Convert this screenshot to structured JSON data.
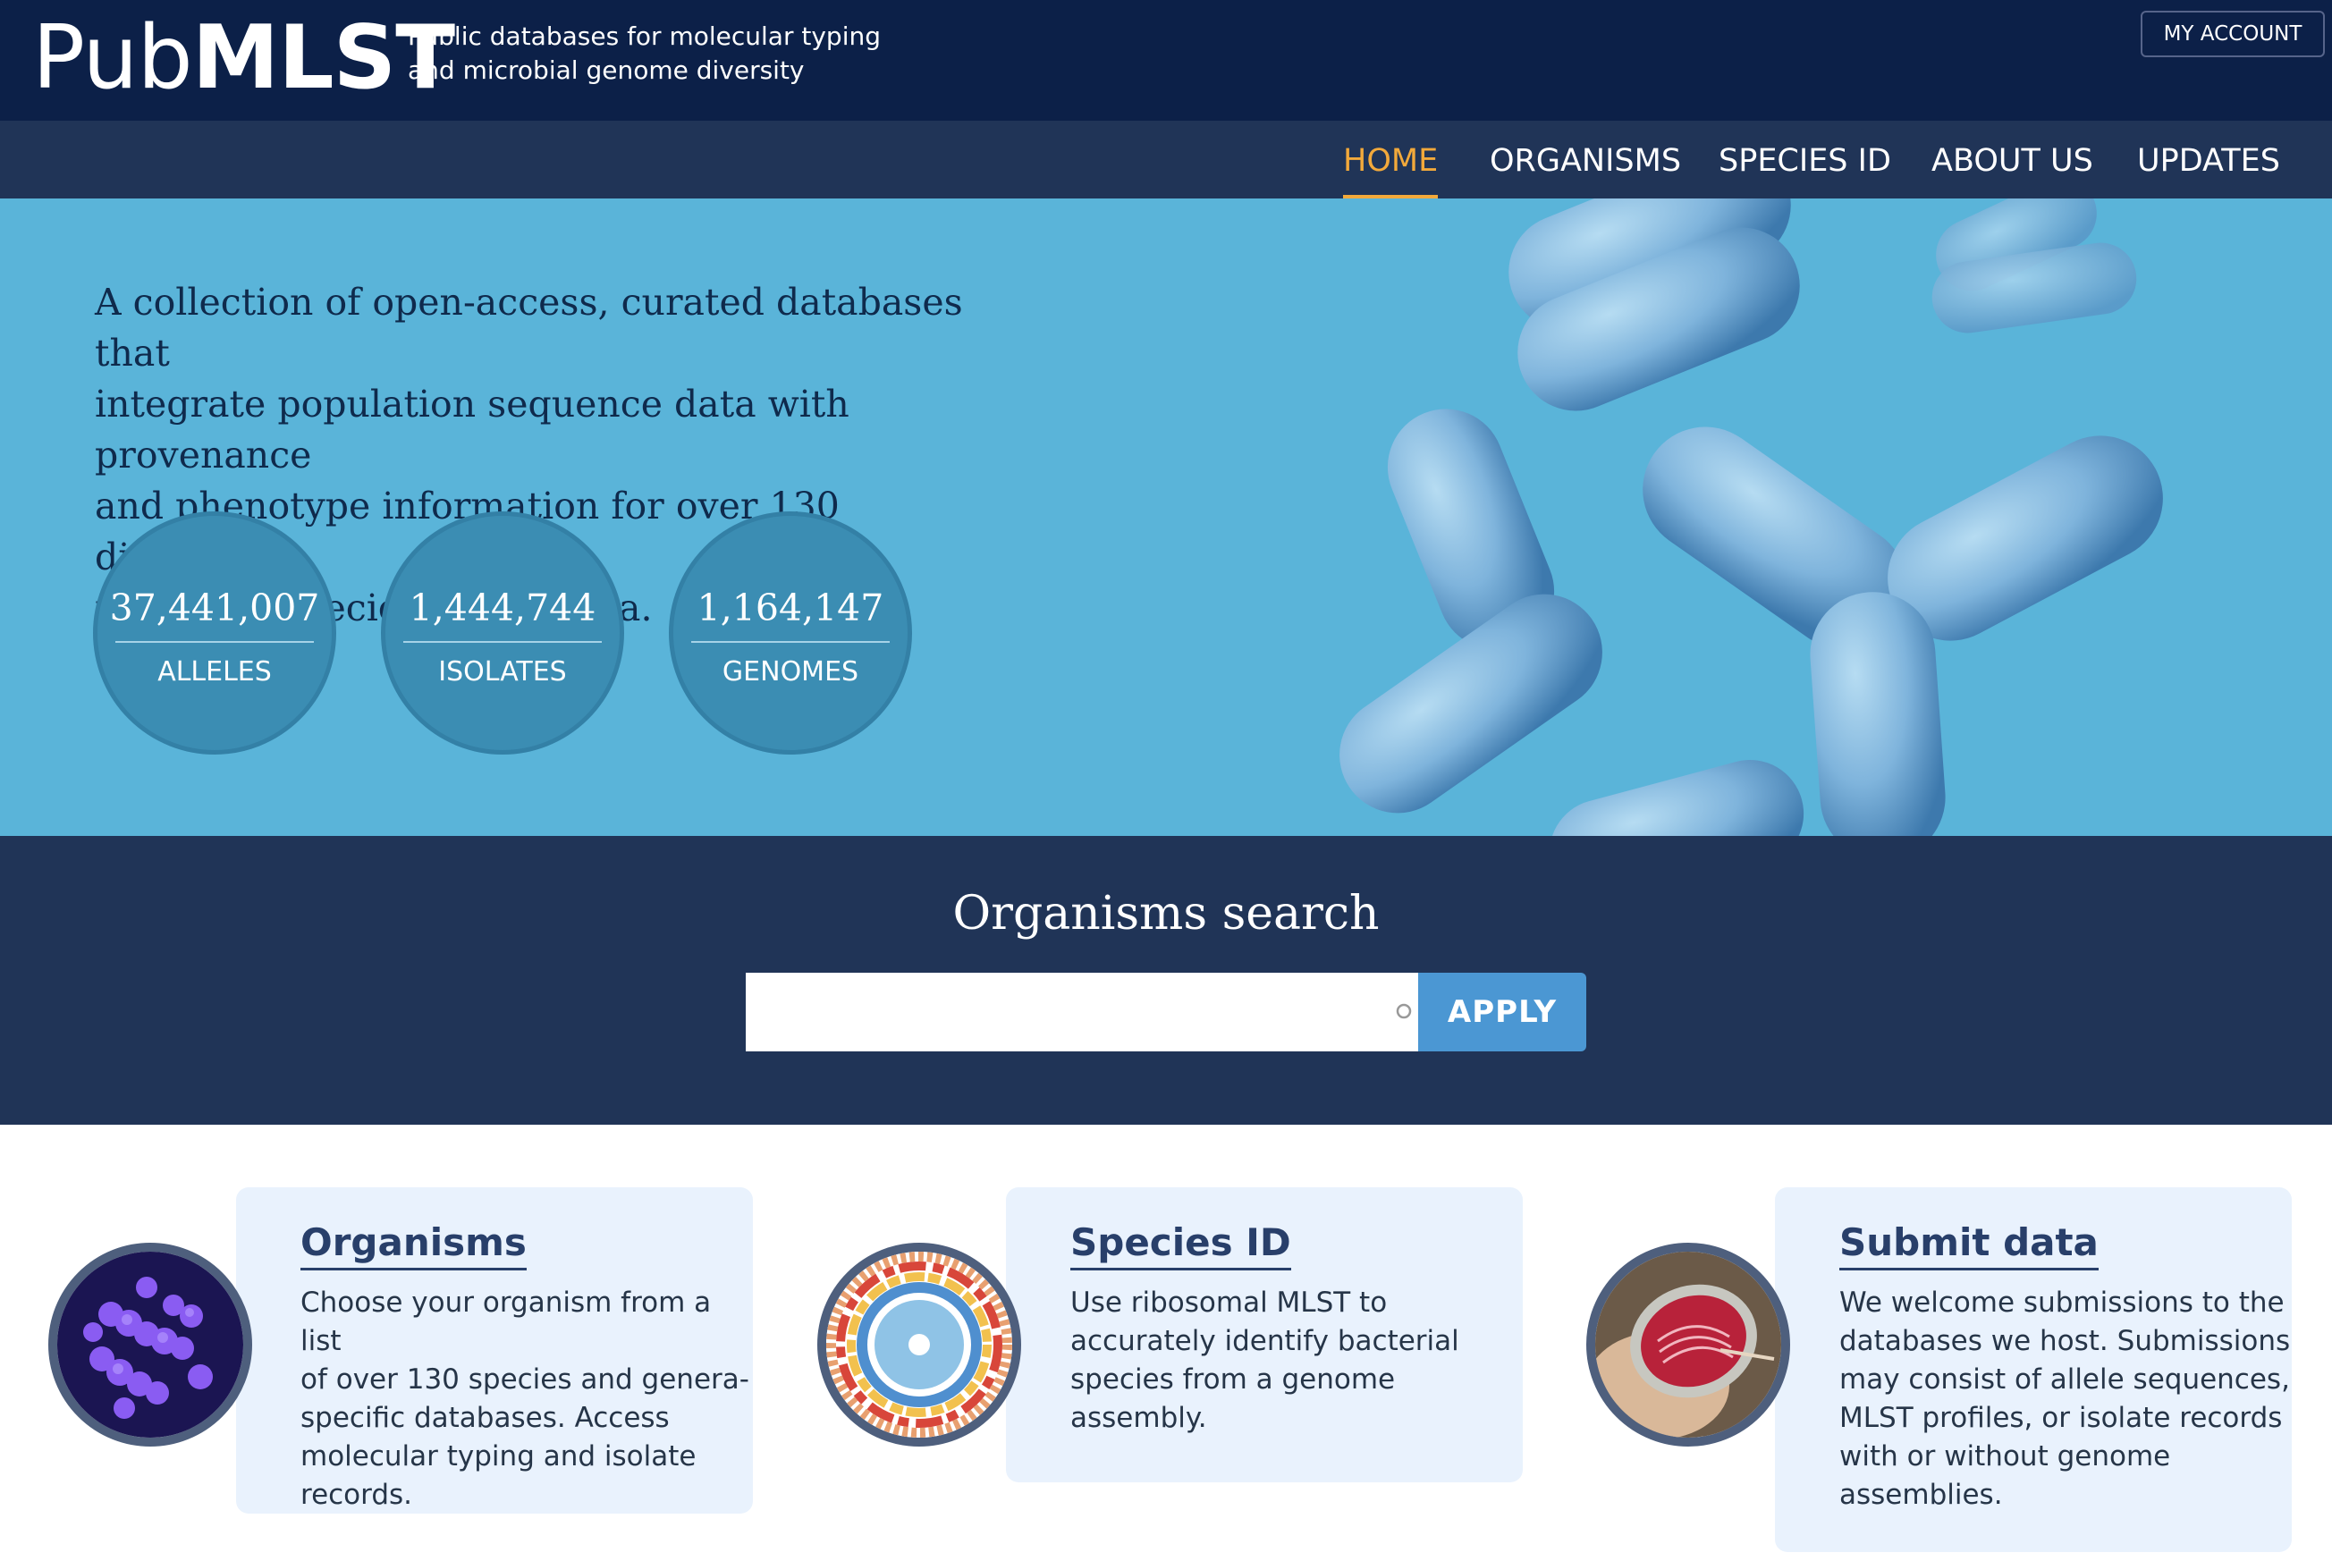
{
  "header": {
    "logo_pub": "Pub",
    "logo_mlst": "MLST",
    "tagline_line1": "Public databases for molecular typing",
    "tagline_line2": "and microbial genome diversity",
    "account_label": "MY ACCOUNT"
  },
  "nav": {
    "items": [
      {
        "label": "HOME",
        "active": true
      },
      {
        "label": "ORGANISMS",
        "active": false
      },
      {
        "label": "SPECIES ID",
        "active": false
      },
      {
        "label": "ABOUT US",
        "active": false
      },
      {
        "label": "UPDATES",
        "active": false
      }
    ]
  },
  "hero": {
    "text_line1": "A collection of open-access, curated databases that",
    "text_line2": "integrate population sequence data with provenance",
    "text_line3": "and phenotype information for over 130 different",
    "text_line4": "microbial species and genera.",
    "stats": [
      {
        "value": "37,441,007",
        "label": "ALLELES"
      },
      {
        "value": "1,444,744",
        "label": "ISOLATES"
      },
      {
        "value": "1,164,147",
        "label": "GENOMES"
      }
    ]
  },
  "search": {
    "title": "Organisms search",
    "placeholder": "",
    "value": "",
    "button_label": "APPLY"
  },
  "cards": [
    {
      "title": "Organisms",
      "line1": "Choose your organism from a list",
      "line2": "of over 130 species and genera-",
      "line3": "specific databases. Access",
      "line4": "molecular typing and isolate",
      "line5": "records."
    },
    {
      "title": "Species ID",
      "line1": "Use ribosomal MLST to",
      "line2": "accurately identify bacterial",
      "line3": "species from a genome assembly."
    },
    {
      "title": "Submit data",
      "line1": "We welcome submissions to the",
      "line2": "databases we host. Submissions",
      "line3": "may consist of allele sequences,",
      "line4": "MLST profiles, or isolate records",
      "line5": "with or without genome",
      "line6": "assemblies."
    }
  ],
  "colors": {
    "header_bg": "#0c2048",
    "nav_bg": "#203457",
    "nav_active": "#f2a93b",
    "hero_bg": "#5ab4d9",
    "stat_circle": "#3b8db3",
    "apply_button": "#4b97d3",
    "card_bg": "#e9f2fd"
  },
  "icons": [
    "search-icon",
    "bacteria-illustration",
    "organisms-thumbnail",
    "species-id-thumbnail",
    "submit-data-thumbnail"
  ]
}
